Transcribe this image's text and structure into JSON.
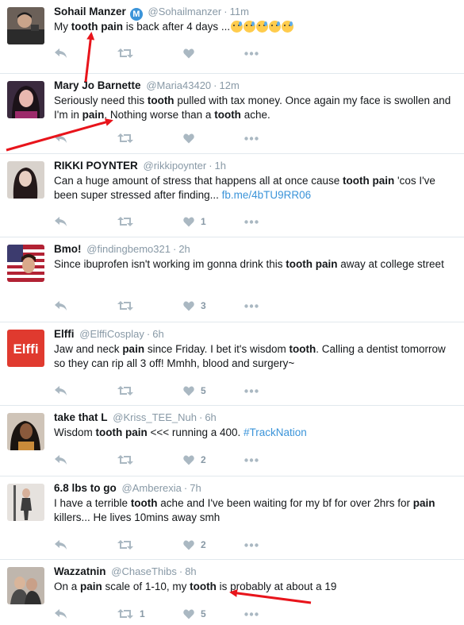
{
  "tweets": [
    {
      "name": "Sohail Manzer",
      "verified_badge": "M",
      "handle": "@Sohailmanzer",
      "time": "11m",
      "segments": [
        {
          "t": "My "
        },
        {
          "t": "tooth",
          "b": true
        },
        {
          "t": " "
        },
        {
          "t": "pain",
          "b": true
        },
        {
          "t": " is back after 4 days ..."
        }
      ],
      "emoji_count": 5,
      "likes": "",
      "retweets": ""
    },
    {
      "name": "Mary Jo Barnette",
      "handle": "@Maria43420",
      "time": "12m",
      "segments": [
        {
          "t": "Seriously need this "
        },
        {
          "t": "tooth",
          "b": true
        },
        {
          "t": " pulled with tax money. Once again my face is swollen and I'm in "
        },
        {
          "t": "pain",
          "b": true
        },
        {
          "t": ".  Nothing worse than a "
        },
        {
          "t": "tooth",
          "b": true
        },
        {
          "t": " ache."
        }
      ],
      "likes": "",
      "retweets": ""
    },
    {
      "name": "RIKKI POYNTER",
      "handle": "@rikkipoynter",
      "time": "1h",
      "segments": [
        {
          "t": "Can a huge amount of stress that happens all at once cause "
        },
        {
          "t": "tooth",
          "b": true
        },
        {
          "t": " "
        },
        {
          "t": "pain",
          "b": true
        },
        {
          "t": " 'cos I've been super stressed after finding... "
        },
        {
          "t": "fb.me/4bTU9RR06",
          "link": true
        }
      ],
      "likes": "1",
      "retweets": ""
    },
    {
      "name": "Bmo!",
      "handle": "@findingbemo321",
      "time": "2h",
      "segments": [
        {
          "t": "Since ibuprofen isn't working im gonna drink this "
        },
        {
          "t": "tooth",
          "b": true
        },
        {
          "t": " "
        },
        {
          "t": "pain",
          "b": true
        },
        {
          "t": " away at college street"
        }
      ],
      "likes": "3",
      "retweets": ""
    },
    {
      "name": "Elffi",
      "handle": "@ElffiCosplay",
      "time": "6h",
      "avatar_text": "Elffi",
      "segments": [
        {
          "t": "Jaw and neck "
        },
        {
          "t": "pain",
          "b": true
        },
        {
          "t": " since Friday. I bet it's wisdom "
        },
        {
          "t": "tooth",
          "b": true
        },
        {
          "t": ". Calling a dentist tomorrow so they can rip all 3 off! Mmhh, blood and surgery~"
        }
      ],
      "likes": "5",
      "retweets": ""
    },
    {
      "name": "take that L",
      "handle": "@Kriss_TEE_Nuh",
      "time": "6h",
      "segments": [
        {
          "t": "Wisdom "
        },
        {
          "t": "tooth",
          "b": true
        },
        {
          "t": " "
        },
        {
          "t": "pain",
          "b": true
        },
        {
          "t": " <<< running a 400. "
        },
        {
          "t": "#TrackNation",
          "link": true
        }
      ],
      "likes": "2",
      "retweets": ""
    },
    {
      "name": "6.8 lbs to go",
      "handle": "@Amberexia",
      "time": "7h",
      "segments": [
        {
          "t": "I have a terrible "
        },
        {
          "t": "tooth",
          "b": true
        },
        {
          "t": " ache and I've been waiting for my bf for over 2hrs for "
        },
        {
          "t": "pain",
          "b": true
        },
        {
          "t": " killers... He lives 10mins away smh"
        }
      ],
      "likes": "2",
      "retweets": ""
    },
    {
      "name": "Wazzatnin",
      "handle": "@ChaseThibs",
      "time": "8h",
      "segments": [
        {
          "t": "On a "
        },
        {
          "t": "pain",
          "b": true
        },
        {
          "t": " scale of 1-10, my "
        },
        {
          "t": "tooth",
          "b": true
        },
        {
          "t": " is probably at about a 19"
        }
      ],
      "likes": "5",
      "retweets": "1"
    }
  ],
  "colors": {
    "name": "#14171a",
    "meta": "#8899a6",
    "link": "#3b94d9",
    "action": "#aab8c2",
    "divider": "#e1e8ed",
    "annotation_arrow": "#e8141b"
  }
}
